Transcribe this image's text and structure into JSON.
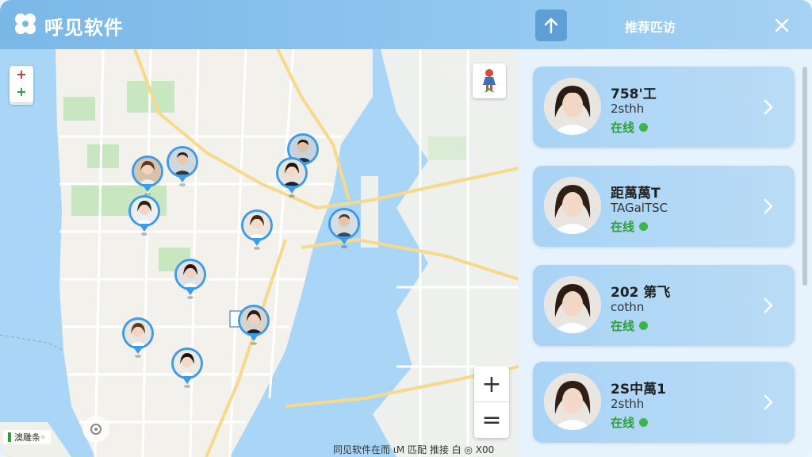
{
  "titlebar": {
    "app_title": "呼见软件",
    "logo_icon": "clover-logo-icon",
    "up_button_icon": "arrow-up-icon",
    "panel_title": "推荐匹访",
    "close_icon": "close-icon"
  },
  "map": {
    "small_controls": [
      "+",
      "+"
    ],
    "zoom_in": "+",
    "zoom_out": "=",
    "legend_text": "澳雕条◦",
    "footer_text": "同见软件在而 ιM 匹配 推接 白 ◎ X00"
  },
  "recommendations": [
    {
      "name": "758'工",
      "sub": "2sthh",
      "status": "在线"
    },
    {
      "name": "距萬萬T",
      "sub": "TAGalTSC",
      "status": "在线"
    },
    {
      "name": "202 第飞",
      "sub": "cothn",
      "status": "在线"
    },
    {
      "name": "2S中萬1",
      "sub": "2sthh",
      "status": "在线"
    }
  ],
  "colors": {
    "title_bar": "#7ab8e8",
    "accent": "#3d9be9",
    "online": "#3cb64a",
    "card": "#a9d3f5"
  }
}
